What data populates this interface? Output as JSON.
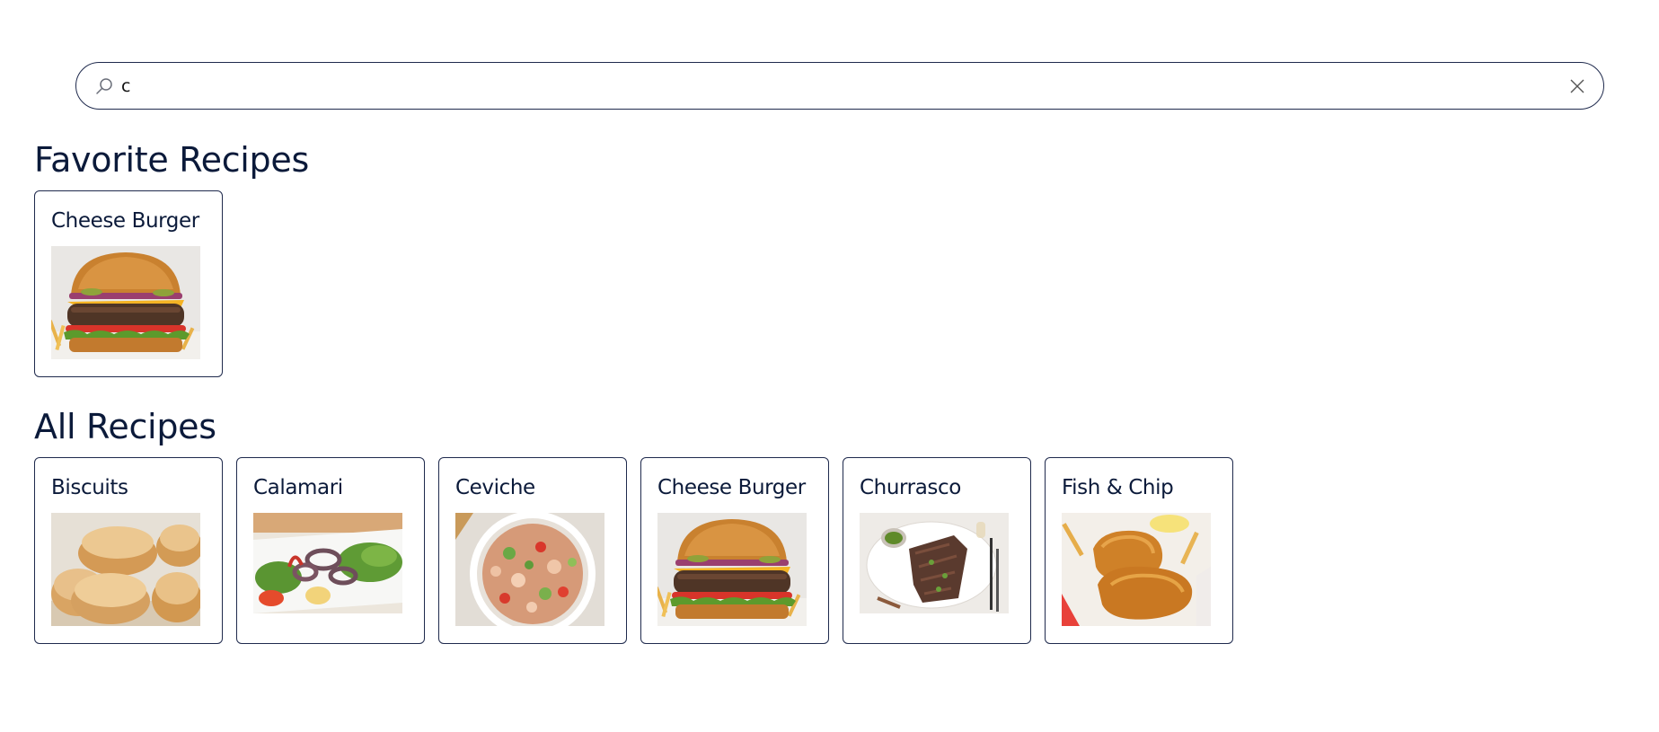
{
  "search": {
    "value": "c",
    "icon": "search-icon",
    "clear_icon": "close-icon"
  },
  "favorites": {
    "title": "Favorite Recipes",
    "items": [
      {
        "name": "Cheese Burger",
        "image": "cheese-burger-photo"
      }
    ]
  },
  "all": {
    "title": "All Recipes",
    "items": [
      {
        "name": "Biscuits",
        "image": "biscuits-photo"
      },
      {
        "name": "Calamari",
        "image": "calamari-photo"
      },
      {
        "name": "Ceviche",
        "image": "ceviche-photo"
      },
      {
        "name": "Cheese Burger",
        "image": "cheese-burger-photo"
      },
      {
        "name": "Churrasco",
        "image": "churrasco-photo"
      },
      {
        "name": "Fish & Chip",
        "image": "fish-and-chip-photo"
      }
    ]
  },
  "colors": {
    "text": "#0b1a3a",
    "border": "#1f2a4d",
    "background": "#ffffff"
  }
}
